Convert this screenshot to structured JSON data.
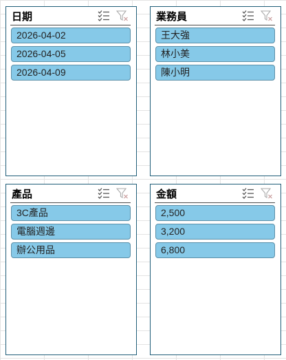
{
  "slicers": [
    {
      "title": "日期",
      "items": [
        "2026-04-02",
        "2026-04-05",
        "2026-04-09"
      ]
    },
    {
      "title": "業務員",
      "items": [
        "王大強",
        "林小美",
        "陳小明"
      ]
    },
    {
      "title": "產品",
      "items": [
        "3C產品",
        "電腦週邊",
        "辦公用品"
      ]
    },
    {
      "title": "金額",
      "items": [
        "2,500",
        "3,200",
        "6,800"
      ]
    }
  ],
  "icons": {
    "multiselect": "multi-select-icon",
    "clear": "clear-filter-icon"
  },
  "colors": {
    "border": "#1f5d78",
    "item_fill": "#86c9e8",
    "item_border": "#5a8fa8"
  }
}
